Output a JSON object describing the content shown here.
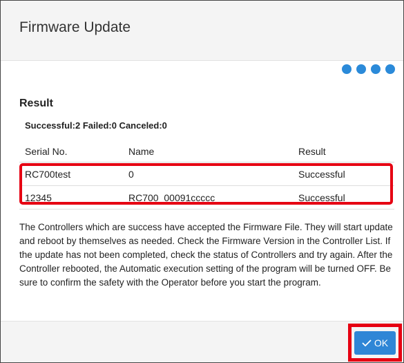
{
  "dialog": {
    "title": "Firmware Update",
    "step_indicator": {
      "total": 4,
      "icon": "progress-dot-icon",
      "color": "#2b8ad9"
    }
  },
  "result": {
    "heading": "Result",
    "summary": "Successful:2 Failed:0 Canceled:0",
    "columns": [
      "Serial No.",
      "Name",
      "Result"
    ],
    "rows": [
      [
        "RC700test",
        "0",
        "Successful"
      ],
      [
        "12345",
        "RC700_00091ccccc",
        "Successful"
      ]
    ],
    "message": "The Controllers which are success have accepted the Firmware File. They will start update and reboot by themselves as needed. Check the Firmware Version in the Controller List. If the update has not been completed, check the status of Controllers and try again. After the Controller rebooted, the Automatic execution setting of the program will be turned OFF. Be sure to confirm the safety with the Operator before you start the program."
  },
  "footer": {
    "ok_label": "OK",
    "ok_icon": "check-icon"
  },
  "colors": {
    "accent": "#2f86d6",
    "highlight": "#e60012"
  }
}
